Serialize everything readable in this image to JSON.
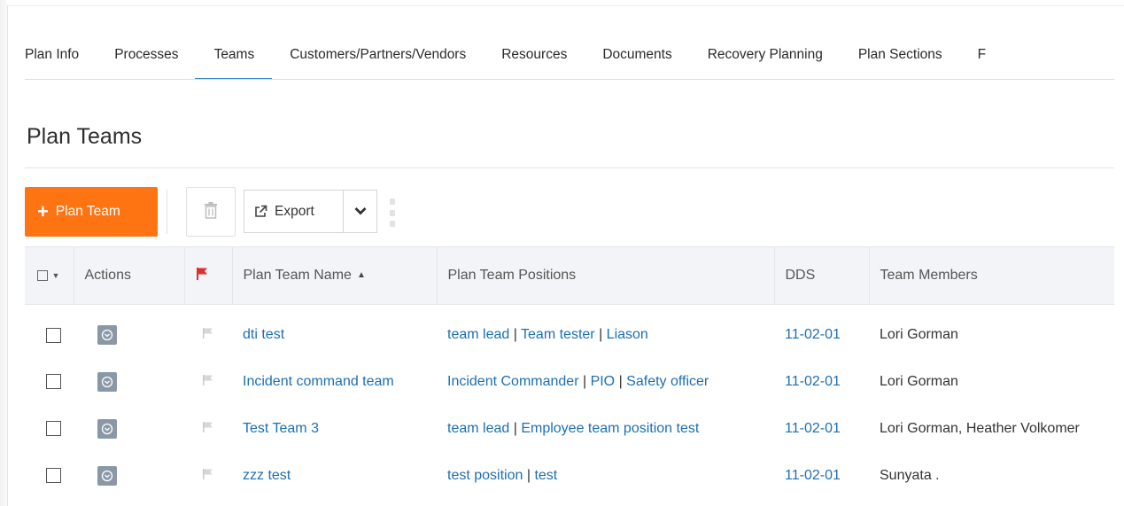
{
  "tabs": [
    {
      "label": "Plan Info"
    },
    {
      "label": "Processes"
    },
    {
      "label": "Teams",
      "active": true
    },
    {
      "label": "Customers/Partners/Vendors"
    },
    {
      "label": "Resources"
    },
    {
      "label": "Documents"
    },
    {
      "label": "Recovery Planning"
    },
    {
      "label": "Plan Sections"
    },
    {
      "label": "F"
    }
  ],
  "page": {
    "title": "Plan Teams"
  },
  "toolbar": {
    "add_label": "Plan Team",
    "export_label": "Export"
  },
  "columns": {
    "actions": "Actions",
    "name": "Plan Team Name",
    "positions": "Plan Team Positions",
    "dds": "DDS",
    "members": "Team Members"
  },
  "rows": [
    {
      "name": "dti test",
      "positions": [
        "team lead",
        "Team tester",
        "Liason"
      ],
      "dds": "11-02-01",
      "members": "Lori Gorman"
    },
    {
      "name": "Incident command team",
      "positions": [
        "Incident Commander",
        "PIO",
        "Safety officer"
      ],
      "dds": "11-02-01",
      "members": "Lori Gorman"
    },
    {
      "name": "Test Team 3",
      "positions": [
        "team lead",
        "Employee team position test"
      ],
      "dds": "11-02-01",
      "members": "Lori Gorman, Heather Volkomer"
    },
    {
      "name": "zzz test",
      "positions": [
        "test position",
        "test"
      ],
      "dds": "11-02-01",
      "members": "Sunyata ."
    }
  ],
  "colors": {
    "accent": "#ff7412",
    "link": "#1d6fb3",
    "tab_active": "#2a86c5",
    "flag": "#e0302e"
  },
  "icons": {
    "add": "plus-icon",
    "delete": "trash-icon",
    "export": "external-link-icon",
    "more": "chevron-down-icon",
    "flag": "flag-icon",
    "row_action": "circle-chevron-icon"
  }
}
